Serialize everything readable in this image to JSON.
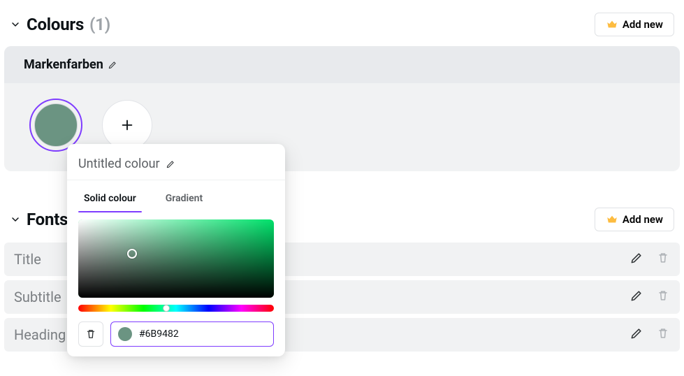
{
  "colours_section": {
    "title": "Colours",
    "count_display": "(1)",
    "add_new_label": "Add new"
  },
  "palette": {
    "name": "Markenfarben",
    "swatches": [
      {
        "hex": "#6B9482"
      }
    ]
  },
  "popover": {
    "title": "Untitled colour",
    "tabs": {
      "solid": "Solid colour",
      "gradient": "Gradient"
    },
    "active_tab": "solid",
    "hex_value": "#6B9482",
    "selected_hue_hex": "#00e26b"
  },
  "fonts_section": {
    "title": "Fonts",
    "add_new_label": "Add new",
    "rows": [
      {
        "label": "Title"
      },
      {
        "label": "Subtitle"
      },
      {
        "label": "Heading"
      }
    ]
  }
}
